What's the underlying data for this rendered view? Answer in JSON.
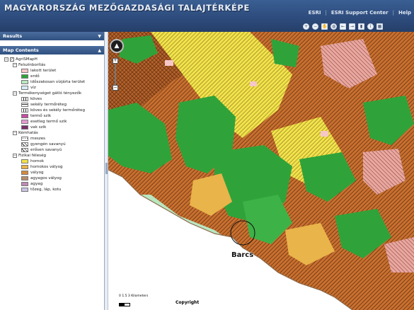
{
  "app": {
    "title": "MAGYARORSZÁG MEZŐGAZDASÁGI TALAJTÉRKÉPE",
    "links": [
      "ESRI",
      "ESRI Support Center",
      "Help"
    ]
  },
  "results_panel": {
    "label": "Results"
  },
  "contents_panel": {
    "label": "Map Contents"
  },
  "toc": {
    "root": "AgriSMapH",
    "groups": [
      {
        "label": "Felszínborítás",
        "items": [
          {
            "label": "lakott terület",
            "swatch": "#f6c7c7"
          },
          {
            "label": "erdő",
            "swatch": "#2fa33a"
          },
          {
            "label": "időszakosan vízjárta terület",
            "swatch": "#b9e7c1"
          },
          {
            "label": "víz",
            "swatch": "#d8eef9"
          }
        ]
      },
      {
        "label": "Termékenységet gátló tényezők",
        "items": [
          {
            "label": "köves",
            "swatch": "#ffffff"
          },
          {
            "label": "sekély termőréteg",
            "swatch": "#ffffff"
          },
          {
            "label": "köves és sekély termőréteg",
            "swatch": "#ffffff"
          },
          {
            "label": "termő szik",
            "swatch": "#c44ea0"
          },
          {
            "label": "esetleg termő szik",
            "swatch": "#e79bd1"
          },
          {
            "label": "vak szik",
            "swatch": "#7a2f6b"
          }
        ]
      },
      {
        "label": "Kémhatás",
        "items": [
          {
            "label": "meszes",
            "swatch": "#ffffff"
          },
          {
            "label": "gyengén savanyú",
            "swatch": "#ffffff"
          },
          {
            "label": "erősen savanyú",
            "swatch": "#ffffff"
          }
        ]
      },
      {
        "label": "Fizikai féleség",
        "items": [
          {
            "label": "homok",
            "swatch": "#f2e24b"
          },
          {
            "label": "homokos vályog",
            "swatch": "#e9b44a"
          },
          {
            "label": "vályog",
            "swatch": "#d58a3d"
          },
          {
            "label": "agyagos vályog",
            "swatch": "#b88c6b"
          },
          {
            "label": "agyag",
            "swatch": "#c08ab6"
          },
          {
            "label": "tőzeg, láp, kotu",
            "swatch": "#c9c4e6"
          }
        ]
      }
    ]
  },
  "map": {
    "place_label": "Barcs",
    "scale_text": "3 Kilometers",
    "scale_start": "0",
    "scale_mid": "1.5",
    "copyright": "Copyright"
  },
  "toolbar": {
    "icons": [
      "zoom-in-icon",
      "zoom-out-icon",
      "pan-hand-icon",
      "globe-icon",
      "back-arrow-icon",
      "forward-arrow-icon",
      "bookmark-icon",
      "info-icon",
      "print-icon"
    ]
  },
  "colors": {
    "header": "#2e4c7d",
    "forest": "#2fa33a",
    "loam": "#c9702f",
    "sand": "#f2e24b",
    "settlement": "#f6c7c7"
  }
}
